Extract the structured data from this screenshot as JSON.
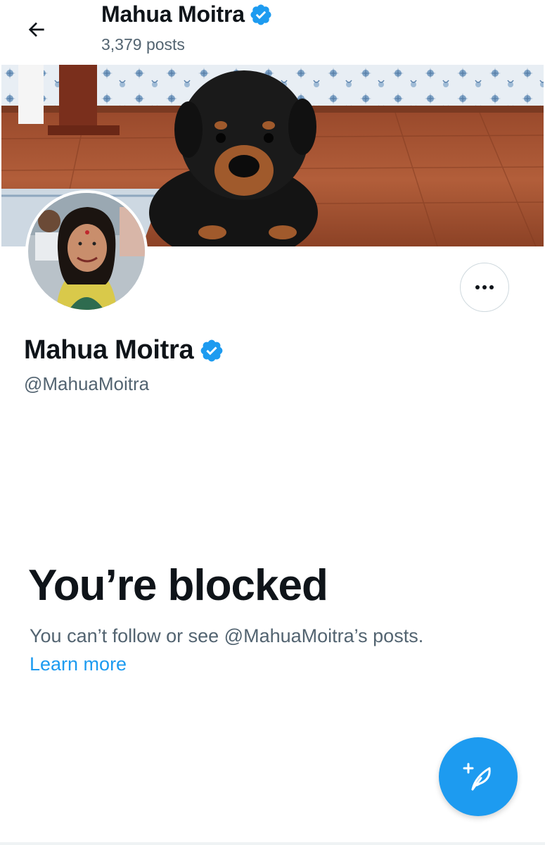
{
  "header": {
    "name": "Mahua Moitra",
    "posts": "3,379 posts"
  },
  "profile": {
    "name": "Mahua Moitra",
    "handle": "@MahuaMoitra",
    "verified": true
  },
  "blocked": {
    "title": "You’re blocked",
    "description": "You can’t follow or see @MahuaMoitra’s posts.",
    "learn_more": "Learn more"
  },
  "icons": {
    "back": "arrow-left-icon",
    "verified": "verified-badge-icon",
    "more": "more-horizontal-icon",
    "compose": "compose-feather-icon"
  },
  "colors": {
    "accent": "#1d9bf0",
    "text": "#0f1419",
    "secondary": "#536471"
  }
}
